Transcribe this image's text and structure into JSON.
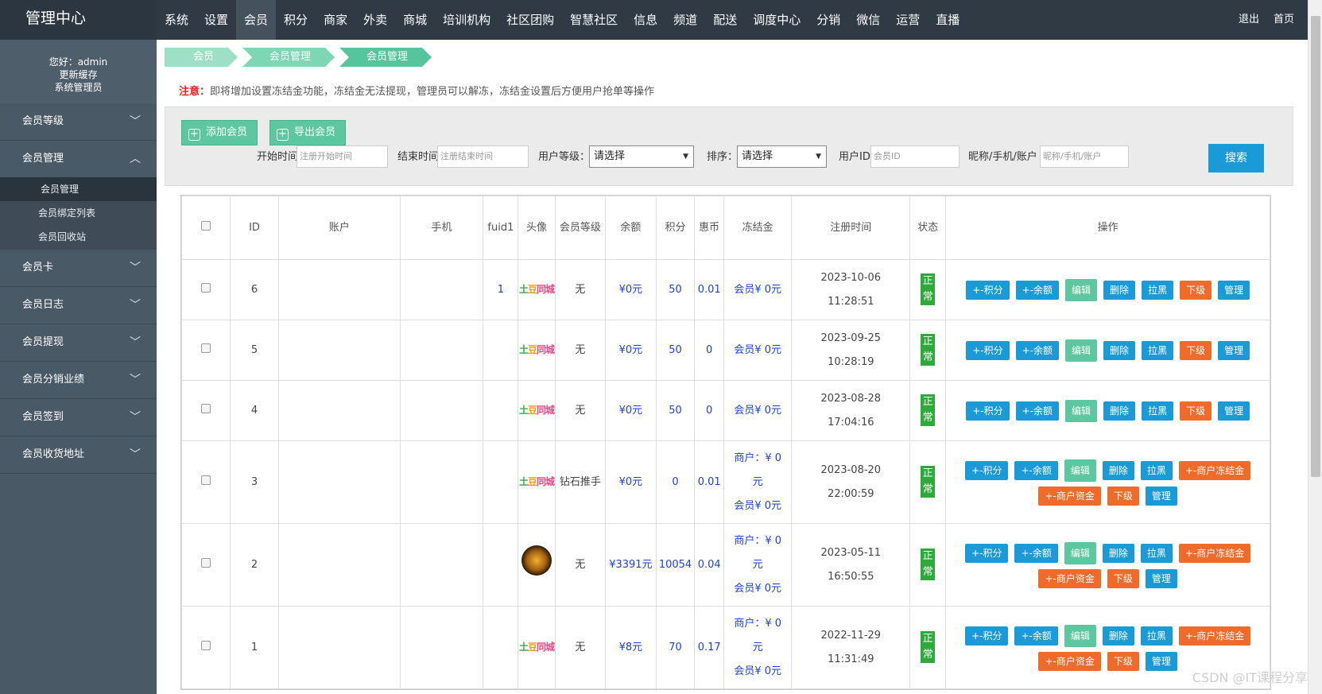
{
  "brand": "管理中心",
  "top_nav": [
    "系统",
    "设置",
    "会员",
    "积分",
    "商家",
    "外卖",
    "商城",
    "培训机构",
    "社区团购",
    "智慧社区",
    "信息",
    "频道",
    "配送",
    "调度中心",
    "分销",
    "微信",
    "运营",
    "直播"
  ],
  "top_nav_active": "会员",
  "top_right": [
    "退出",
    "首页"
  ],
  "user": {
    "greeting": "您好：admin",
    "refresh": "更新缓存",
    "role": "系统管理员"
  },
  "sidebar": [
    {
      "label": "会员等级",
      "expanded": false
    },
    {
      "label": "会员管理",
      "expanded": true,
      "children": [
        "会员管理",
        "会员绑定列表",
        "会员回收站"
      ]
    },
    {
      "label": "会员卡",
      "expanded": false
    },
    {
      "label": "会员日志",
      "expanded": false
    },
    {
      "label": "会员提现",
      "expanded": false
    },
    {
      "label": "会员分销业绩",
      "expanded": false
    },
    {
      "label": "会员签到",
      "expanded": false
    },
    {
      "label": "会员收货地址",
      "expanded": false
    }
  ],
  "breadcrumb": [
    "会员",
    "会员管理",
    "会员管理"
  ],
  "notice": {
    "label": "注意：",
    "text": "即将增加设置冻结金功能，冻结金无法提现，管理员可以解冻，冻结金设置后方便用户抢单等操作"
  },
  "toolbar": {
    "add": "添加会员",
    "export": "导出会员"
  },
  "filters": {
    "start_label": "开始时间",
    "start_placeholder": "注册开始时间",
    "end_label": "结束时间",
    "end_placeholder": "注册结束时间",
    "level_label": "用户等级：",
    "level_value": "请选择",
    "sort_label": "排序：",
    "sort_value": "请选择",
    "uid_label": "用户ID",
    "uid_placeholder": "会员ID",
    "nick_label": "昵称/手机/账户",
    "nick_placeholder": "昵称/手机/账户",
    "search": "搜索"
  },
  "table": {
    "headers": [
      "ID",
      "账户",
      "手机",
      "fuid1",
      "头像",
      "会员等级",
      "余额",
      "积分",
      "惠币",
      "冻结金",
      "注册时间",
      "状态",
      "操作"
    ],
    "rows": [
      {
        "id": "6",
        "account": "",
        "phone": "",
        "fuid1": "1",
        "avatar": "logo",
        "level": "无",
        "balance": "¥0元",
        "points": "50",
        "coins": "0.01",
        "frozen": [
          "会员¥ 0元"
        ],
        "date": "2023-10-06",
        "time": "11:28:51",
        "status": "正常",
        "ops": [
          "+-积分",
          "+-余额",
          "编辑",
          "删除",
          "拉黑",
          "下级",
          "管理"
        ]
      },
      {
        "id": "5",
        "account": "",
        "phone": "",
        "fuid1": "",
        "avatar": "logo",
        "level": "无",
        "balance": "¥0元",
        "points": "50",
        "coins": "0",
        "frozen": [
          "会员¥ 0元"
        ],
        "date": "2023-09-25",
        "time": "10:28:19",
        "status": "正常",
        "ops": [
          "+-积分",
          "+-余额",
          "编辑",
          "删除",
          "拉黑",
          "下级",
          "管理"
        ]
      },
      {
        "id": "4",
        "account": "",
        "phone": "",
        "fuid1": "",
        "avatar": "logo",
        "level": "无",
        "balance": "¥0元",
        "points": "50",
        "coins": "0",
        "frozen": [
          "会员¥ 0元"
        ],
        "date": "2023-08-28",
        "time": "17:04:16",
        "status": "正常",
        "ops": [
          "+-积分",
          "+-余额",
          "编辑",
          "删除",
          "拉黑",
          "下级",
          "管理"
        ]
      },
      {
        "id": "3",
        "account": "",
        "phone": "",
        "fuid1": "",
        "avatar": "logo",
        "level": "钻石推手",
        "balance": "¥0元",
        "points": "0",
        "coins": "0.01",
        "frozen": [
          "商户：¥ 0",
          "元",
          "会员¥ 0元"
        ],
        "date": "2023-08-20",
        "time": "22:00:59",
        "status": "正常",
        "ops": [
          "+-积分",
          "+-余额",
          "编辑",
          "删除",
          "拉黑",
          "+-商户冻结金",
          "+-商户资金",
          "下级",
          "管理"
        ]
      },
      {
        "id": "2",
        "account": "",
        "phone": "",
        "fuid1": "",
        "avatar": "gem",
        "level": "无",
        "balance": "¥3391元",
        "points": "10054",
        "coins": "0.04",
        "frozen": [
          "商户：¥ 0",
          "元",
          "会员¥ 0元"
        ],
        "date": "2023-05-11",
        "time": "16:50:55",
        "status": "正常",
        "ops": [
          "+-积分",
          "+-余额",
          "编辑",
          "删除",
          "拉黑",
          "+-商户冻结金",
          "+-商户资金",
          "下级",
          "管理"
        ]
      },
      {
        "id": "1",
        "account": "",
        "phone": "",
        "fuid1": "",
        "avatar": "logo",
        "level": "无",
        "balance": "¥8元",
        "points": "70",
        "coins": "0.17",
        "frozen": [
          "商户：¥ 0",
          "元",
          "会员¥ 0元"
        ],
        "date": "2022-11-29",
        "time": "11:31:49",
        "status": "正常",
        "ops": [
          "+-积分",
          "+-余额",
          "编辑",
          "删除",
          "拉黑",
          "+-商户冻结金",
          "+-商户资金",
          "下级",
          "管理"
        ]
      }
    ]
  },
  "avatar_logo_text": "土豆同城",
  "watermark": "CSDN @IT课程分享"
}
